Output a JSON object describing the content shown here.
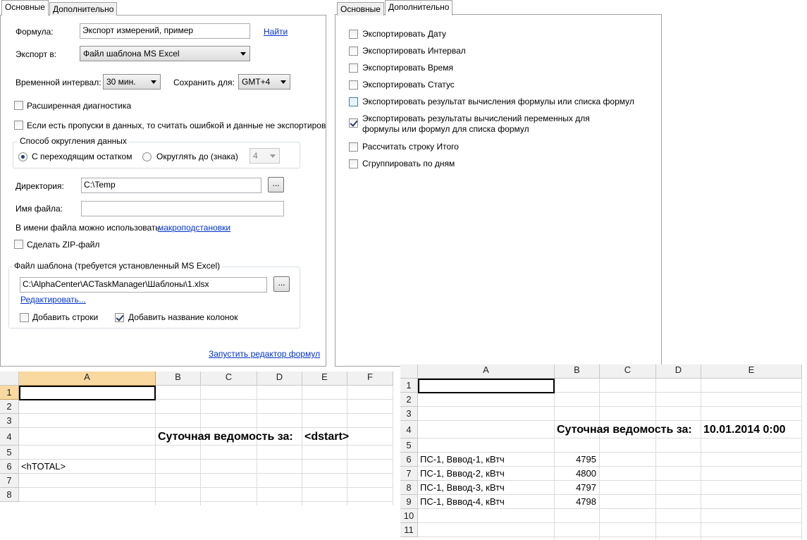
{
  "left_dialog": {
    "tabs": [
      "Основные",
      "Дополнительно"
    ],
    "formula_label": "Формула:",
    "formula_value": "Экспорт измерений, пример",
    "find_link": "Найти",
    "export_label": "Экспорт в:",
    "export_value": "Файл шаблона MS Excel",
    "interval_label": "Временной интервал:",
    "interval_value": "30 мин.",
    "save_for_label": "Сохранить для:",
    "timezone_value": "GMT+4",
    "ext_diag": "Расширенная диагностика",
    "gaps_error": "Если есть пропуски в данных, то считать ошибкой и данные не экспортиров",
    "rounding_group": "Способ округления данных",
    "rounding_carry": "С переходящим остатком",
    "rounding_round": "Округлять до (знака)",
    "rounding_digits": "4",
    "dir_label": "Директория:",
    "dir_value": "C:\\Temp",
    "browse": "...",
    "filename_label": "Имя файла:",
    "filename_value": "",
    "macro_hint": "В имени файла можно использовать",
    "macro_link": "макроподстановки",
    "zip": "Сделать ZIP-файл",
    "template_group": "Файл шаблона (требуется установленный MS Excel)",
    "template_path": "C:\\AlphaCenter\\ACTaskManager\\Шаблоны\\1.xlsx",
    "edit_link": "Редактировать...",
    "add_rows": "Добавить строки",
    "add_col_names": "Добавить название колонок",
    "formula_editor_link": "Запустить редактор формул"
  },
  "right_dialog": {
    "tabs": [
      "Основные",
      "Дополнительно"
    ],
    "options": [
      {
        "label": "Экспортировать Дату",
        "checked": false
      },
      {
        "label": "Экспортировать Интервал",
        "checked": false
      },
      {
        "label": "Экспортировать Время",
        "checked": false
      },
      {
        "label": "Экспортировать Статус",
        "checked": false
      },
      {
        "label": "Экспортировать результат вычисления формулы или списка формул",
        "checked": false
      },
      {
        "label": "Экспортировать результаты вычислений переменных для",
        "label2": "формулы или формул для списка формул",
        "checked": true
      },
      {
        "label": "Рассчитать строку Итого",
        "checked": false
      },
      {
        "label": "Сгруппировать по дням",
        "checked": false
      }
    ]
  },
  "excel_template": {
    "columns": [
      "A",
      "B",
      "C",
      "D",
      "E",
      "F"
    ],
    "rows": [
      "1",
      "2",
      "3",
      "4",
      "5",
      "6",
      "7",
      "8"
    ],
    "b4": "Суточная ведомость за:",
    "e4": "<dstart>",
    "a6": "<hTOTAL>"
  },
  "excel_result": {
    "columns": [
      "A",
      "B",
      "C",
      "D",
      "E"
    ],
    "rows": [
      "1",
      "2",
      "3",
      "4",
      "5",
      "6",
      "7",
      "8",
      "9",
      "10",
      "11"
    ],
    "b4": "Суточная ведомость за:",
    "e4": "10.01.2014 0:00",
    "data": [
      {
        "name": "ПС-1, Вввод-1, кВтч",
        "value": "4795"
      },
      {
        "name": "ПС-1, Вввод-2, кВтч",
        "value": "4800"
      },
      {
        "name": "ПС-1, Вввод-3, кВтч",
        "value": "4797"
      },
      {
        "name": "ПС-1, Вввод-4, кВтч",
        "value": "4798"
      }
    ]
  }
}
